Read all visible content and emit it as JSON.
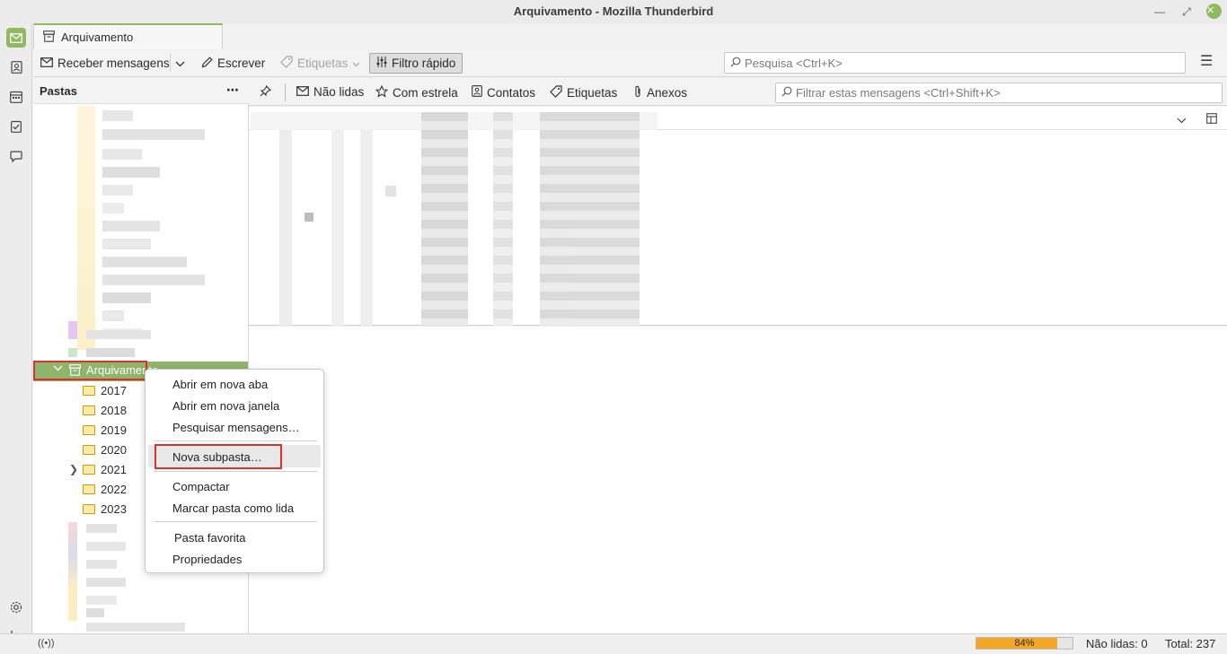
{
  "window": {
    "title": "Arquivamento - Mozilla Thunderbird"
  },
  "tab": {
    "label": "Arquivamento"
  },
  "toolbar": {
    "get_messages": "Receber mensagens",
    "write": "Escrever",
    "tags": "Etiquetas",
    "quick_filter": "Filtro rápido",
    "search_placeholder": "Pesquisa <Ctrl+K>"
  },
  "folder_pane": {
    "title": "Pastas",
    "selected_folder": "Arquivamento",
    "subfolders": [
      "2017",
      "2018",
      "2019",
      "2020",
      "2021",
      "2022",
      "2023"
    ]
  },
  "quick_filter_bar": {
    "unread": "Não lidas",
    "starred": "Com estrela",
    "contacts": "Contatos",
    "tags": "Etiquetas",
    "attachments": "Anexos",
    "filter_placeholder": "Filtrar estas mensagens <Ctrl+Shift+K>"
  },
  "context_menu": {
    "open_new_tab": "Abrir em nova aba",
    "open_new_window": "Abrir em nova janela",
    "search_messages": "Pesquisar mensagens…",
    "new_subfolder": "Nova subpasta…",
    "compact": "Compactar",
    "mark_read": "Marcar pasta como lida",
    "favorite": "Pasta favorita",
    "properties": "Propriedades"
  },
  "status_bar": {
    "progress_percent": 84,
    "progress_label": "84%",
    "unread": "Não lidas: 0",
    "total": "Total: 237"
  },
  "colors": {
    "accent": "#8fba5e",
    "highlight_outline": "#d9342b",
    "progress": "#f5a623"
  }
}
